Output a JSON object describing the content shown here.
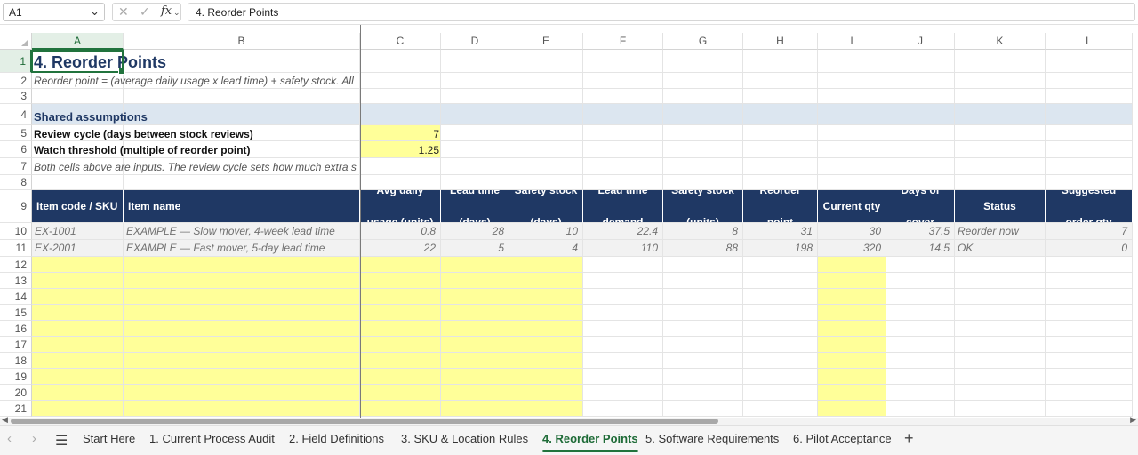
{
  "formula_bar": {
    "name_box": "A1",
    "formula": "4. Reorder Points",
    "cancel_icon": "✕",
    "enter_icon": "✓",
    "fx_label": "fx"
  },
  "columns": [
    "A",
    "B",
    "C",
    "D",
    "E",
    "F",
    "G",
    "H",
    "I",
    "J",
    "K",
    "L"
  ],
  "rows": [
    "1",
    "2",
    "3",
    "4",
    "5",
    "6",
    "7",
    "8",
    "9",
    "10",
    "11",
    "12",
    "13",
    "14",
    "15",
    "16",
    "17",
    "18",
    "19",
    "20",
    "21"
  ],
  "sheet": {
    "title": "4. Reorder Points",
    "subtitle": "Reorder point = (average daily usage x lead time) + safety stock. All",
    "assumptions_header": "Shared assumptions",
    "review_cycle_label": "Review cycle (days between stock reviews)",
    "review_cycle_value": "7",
    "watch_threshold_label": "Watch threshold (multiple of reorder point)",
    "watch_threshold_value": "1.25",
    "note": "Both cells above are inputs. The review cycle sets how much extra s",
    "table_headers": [
      "Item code / SKU",
      "Item name",
      "Avg daily usage (units)",
      "Lead time (days)",
      "Safety stock (days)",
      "Lead time demand",
      "Safety stock (units)",
      "Reorder point",
      "Current qty",
      "Days of cover",
      "Status",
      "Suggested order qty"
    ],
    "example_rows": [
      [
        "EX-1001",
        "EXAMPLE — Slow mover, 4-week lead time",
        "0.8",
        "28",
        "10",
        "22.4",
        "8",
        "31",
        "30",
        "37.5",
        "Reorder now",
        "7"
      ],
      [
        "EX-2001",
        "EXAMPLE — Fast mover, 5-day lead time",
        "22",
        "5",
        "4",
        "110",
        "88",
        "198",
        "320",
        "14.5",
        "OK",
        "0"
      ]
    ]
  },
  "tabs": {
    "items": [
      "Start Here",
      "1. Current Process Audit",
      "2. Field Definitions",
      "3. SKU & Location Rules",
      "4. Reorder Points",
      "5. Software Requirements",
      "6. Pilot Acceptance"
    ],
    "active": "4. Reorder Points"
  },
  "colors": {
    "header_fill": "#1f3864",
    "input_fill": "#ffff99",
    "band_fill": "#dce6f0",
    "accent_green": "#21733d"
  }
}
